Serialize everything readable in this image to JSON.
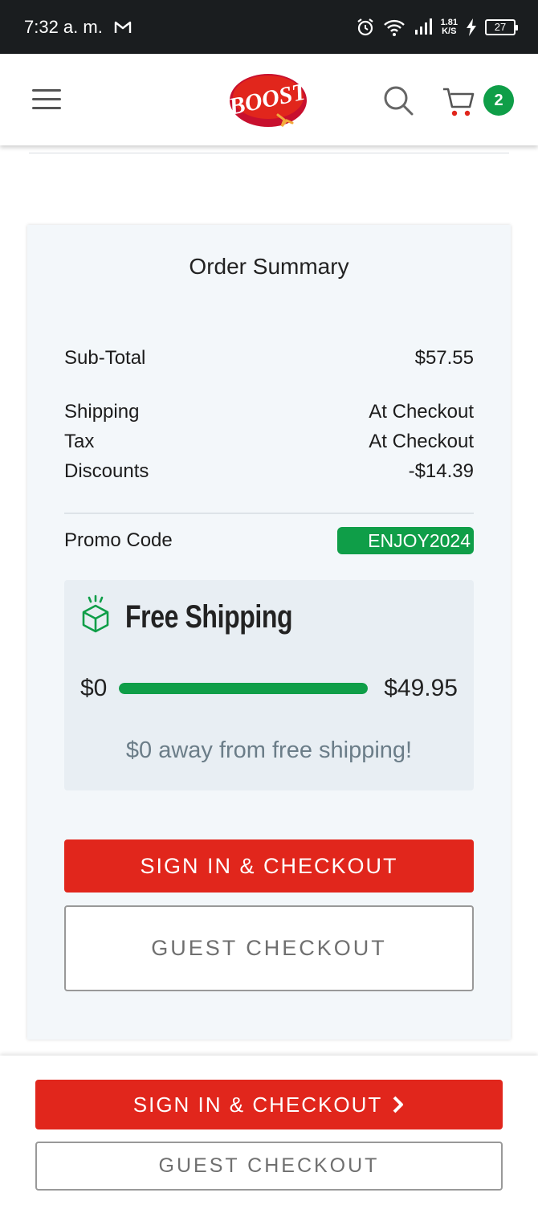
{
  "status_bar": {
    "time": "7:32 a. m.",
    "mail_icon": "gmail-icon",
    "speed_value": "1.81",
    "speed_unit": "K/S",
    "battery": "27"
  },
  "header": {
    "logo_text": "BOOST",
    "cart_count": "2"
  },
  "summary": {
    "title": "Order Summary",
    "rows": [
      {
        "label": "Sub-Total",
        "value": "$57.55"
      },
      {
        "label": "Shipping",
        "value": "At Checkout"
      },
      {
        "label": "Tax",
        "value": "At Checkout"
      },
      {
        "label": "Discounts",
        "value": "-$14.39"
      }
    ],
    "promo_label": "Promo Code",
    "promo_code": "ENJOY2024"
  },
  "free_shipping": {
    "title": "Free Shipping",
    "min": "$0",
    "max": "$49.95",
    "progress": 1.0,
    "message": "$0 away from free shipping!"
  },
  "buttons": {
    "sign_in_checkout": "SIGN IN & CHECKOUT",
    "guest_checkout": "GUEST CHECKOUT"
  },
  "footer": {
    "sign_in_checkout": "SIGN IN & CHECKOUT",
    "guest_checkout": "GUEST CHECKOUT"
  },
  "colors": {
    "brand_red": "#e1261c",
    "accent_green": "#0f9e48"
  }
}
